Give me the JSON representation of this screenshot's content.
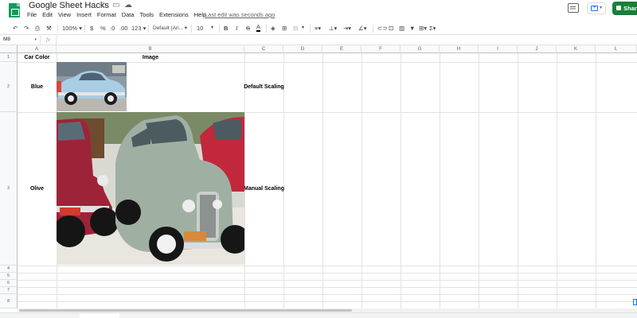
{
  "app": {
    "title": "Google Sheet Hacks",
    "last_edit": "Last edit was seconds ago",
    "share_label": "Share",
    "accent_color": "#188038"
  },
  "menu": [
    "File",
    "Edit",
    "View",
    "Insert",
    "Format",
    "Data",
    "Tools",
    "Extensions",
    "Help"
  ],
  "toolbar": {
    "zoom": "100%",
    "currency": "$",
    "percent": "%",
    "dec_decrease": ".0",
    "dec_increase": ".00",
    "more_formats": "123",
    "font": "Default (Ari...",
    "font_size": "10",
    "bold": "B",
    "italic": "I",
    "strike": "S",
    "text_color": "A"
  },
  "formula_bar": {
    "name_box": "M8",
    "fx": "fx",
    "value": ""
  },
  "columns": [
    "A",
    "B",
    "C",
    "D",
    "E",
    "F",
    "G",
    "H",
    "I",
    "J",
    "K",
    "L"
  ],
  "rows": [
    "1",
    "2",
    "3",
    "4",
    "5",
    "6",
    "7",
    "8"
  ],
  "cells": {
    "a1": "Car Color",
    "b1": "Image",
    "a2": "Blue",
    "c2": "Default Scaling",
    "a3": "Olive",
    "c3": "Manual Scaling"
  },
  "images": {
    "b2": "blue-vintage-car-photo",
    "b3": "olive-vintage-car-photo"
  }
}
